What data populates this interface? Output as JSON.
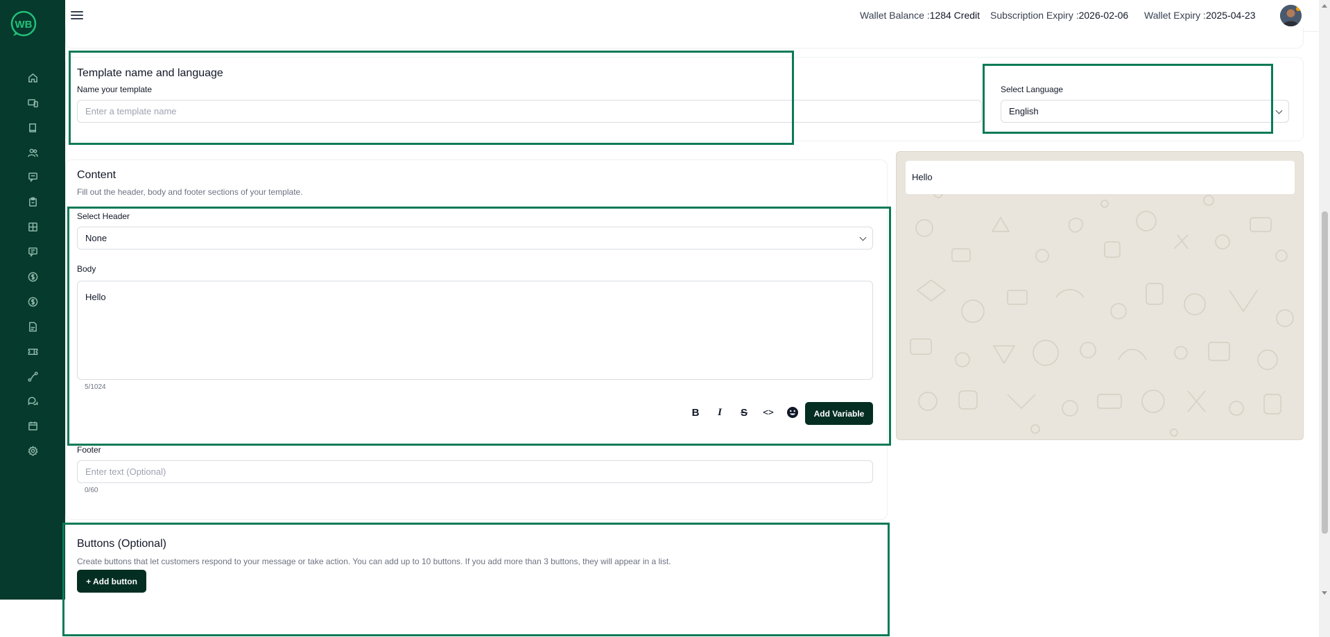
{
  "app": {
    "logo_text": "WB"
  },
  "sidebar": {
    "items": [
      {
        "name": "home-icon"
      },
      {
        "name": "devices-icon"
      },
      {
        "name": "book-icon"
      },
      {
        "name": "users-icon"
      },
      {
        "name": "message-icon"
      },
      {
        "name": "clipboard-icon"
      },
      {
        "name": "grid-icon"
      },
      {
        "name": "chat-icon"
      },
      {
        "name": "dollar-icon"
      },
      {
        "name": "dollar-circle-icon"
      },
      {
        "name": "pdf-icon"
      },
      {
        "name": "ticket-icon"
      },
      {
        "name": "flow-icon"
      },
      {
        "name": "chats-icon"
      },
      {
        "name": "calendar-icon"
      },
      {
        "name": "settings-icon"
      }
    ]
  },
  "header": {
    "wallet_balance_label": "Wallet Balance :",
    "wallet_balance_value": "1284 Credit",
    "subscription_label": "Subscription Expiry :",
    "subscription_value": "2026-02-06",
    "wallet_expiry_label": "Wallet Expiry :",
    "wallet_expiry_value": "2025-04-23"
  },
  "template": {
    "section_title": "Template name and language",
    "name_label": "Name your template",
    "name_placeholder": "Enter a template name",
    "language_label": "Select Language",
    "language_value": "English"
  },
  "content": {
    "title": "Content",
    "subtitle": "Fill out the header, body and footer sections of your template.",
    "header_label": "Select Header",
    "header_value": "None",
    "body_label": "Body",
    "body_value": "Hello",
    "body_count": "5/1024",
    "format_bold": "B",
    "format_italic": "I",
    "format_strike": "S",
    "format_code": "<>",
    "add_variable": "Add Variable",
    "footer_label": "Footer",
    "footer_placeholder": "Enter text (Optional)",
    "footer_count": "0/60"
  },
  "buttons": {
    "title": "Buttons (Optional)",
    "description": "Create buttons that let customers respond to your message or take action. You can add up to 10 buttons. If you add more than 3 buttons, they will appear in a list.",
    "add_button": "+ Add button"
  },
  "preview": {
    "message": "Hello"
  },
  "colors": {
    "sidebar": "#053a2c",
    "accent": "#0a7a56",
    "dark_button": "#052e22",
    "preview_bg": "#e9e4dc"
  }
}
